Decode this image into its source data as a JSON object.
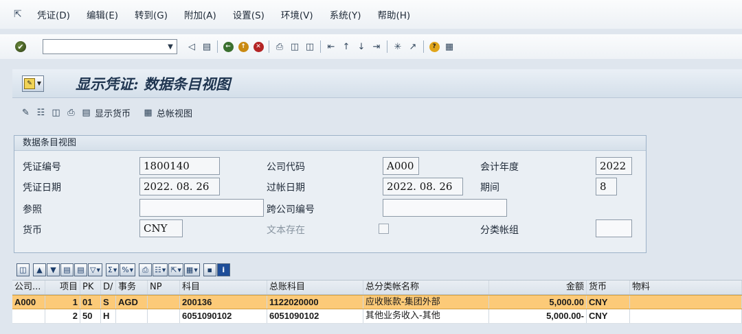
{
  "menubar": {
    "items": [
      {
        "label": "凭证(D)"
      },
      {
        "label": "编辑(E)"
      },
      {
        "label": "转到(G)"
      },
      {
        "label": "附加(A)"
      },
      {
        "label": "设置(S)"
      },
      {
        "label": "环境(V)"
      },
      {
        "label": "系统(Y)"
      },
      {
        "label": "帮助(H)"
      }
    ]
  },
  "systemToolbar": {
    "command_value": "",
    "icons": [
      "enter-icon",
      "back-icon",
      "save-icon",
      "back-green-icon",
      "exit-icon",
      "cancel-icon",
      "print-icon",
      "find-icon",
      "find-next-icon",
      "first-page-icon",
      "prev-page-icon",
      "next-page-icon",
      "last-page-icon",
      "new-session-icon",
      "shortcut-icon",
      "help-icon",
      "customize-layout-icon"
    ]
  },
  "title": {
    "text": "显示凭证: 数据条目视图"
  },
  "appToolbar": {
    "display_currency": "显示货币",
    "general_ledger_view": "总帐视图"
  },
  "header": {
    "group_title": "数据条目视图",
    "doc_number_label": "凭证编号",
    "doc_number": "1800140",
    "company_code_label": "公司代码",
    "company_code": "A000",
    "fiscal_year_label": "会计年度",
    "fiscal_year": "2022",
    "doc_date_label": "凭证日期",
    "doc_date": "2022. 08. 26",
    "posting_date_label": "过帐日期",
    "posting_date": "2022. 08. 26",
    "period_label": "期间",
    "period": "8",
    "reference_label": "参照",
    "reference": "",
    "cross_company_label": "跨公司编号",
    "cross_company": "",
    "currency_label": "货币",
    "currency": "CNY",
    "text_exists_label": "文本存在",
    "ledger_group_label": "分类帐组",
    "ledger_group": ""
  },
  "grid": {
    "columns": [
      "公司...",
      "项目",
      "PK",
      "D/",
      "事务",
      "NP",
      "科目",
      "总账科目",
      "总分类帐名称",
      "金额",
      "货币",
      "物料"
    ],
    "rows": [
      [
        "A000",
        "1",
        "01",
        "S",
        "AGD",
        "",
        "200136",
        "1122020000",
        "应收账款-集团外部",
        "5,000.00",
        "CNY",
        ""
      ],
      [
        "",
        "2",
        "50",
        "H",
        "",
        "",
        "6051090102",
        "6051090102",
        "其他业务收入-其他",
        "5,000.00-",
        "CNY",
        ""
      ]
    ]
  }
}
